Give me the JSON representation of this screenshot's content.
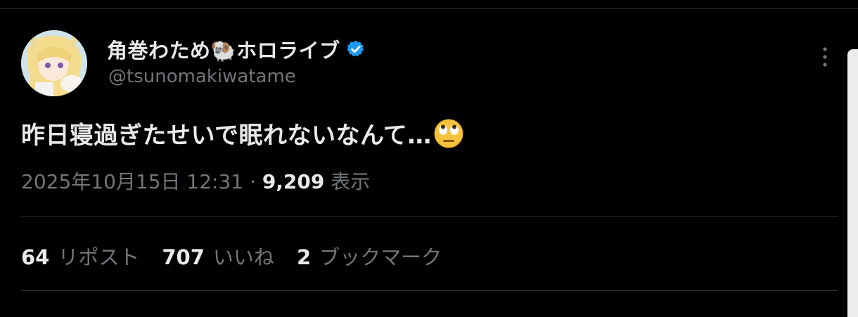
{
  "tweet": {
    "display_name": "角巻わため🐏ホロライブ",
    "handle": "@tsunomakiwatame",
    "text": "昨日寝過ぎたせいで眠れないなんて…",
    "timestamp": "2025年10月15日 12:31",
    "separator": " · ",
    "views_count": "9,209",
    "views_label": "表示"
  },
  "stats": [
    {
      "count": "64",
      "label": "リポスト"
    },
    {
      "count": "707",
      "label": "いいね"
    },
    {
      "count": "2",
      "label": "ブックマーク"
    }
  ],
  "icons": {
    "verified": "verified-badge-icon",
    "more": "more-options-icon",
    "emoji": "eye-roll-emoji-icon"
  },
  "colors": {
    "background": "#000000",
    "text": "#e7e9ea",
    "muted": "#71767b",
    "verified": "#1d9bf0",
    "divider": "#2f3336"
  }
}
